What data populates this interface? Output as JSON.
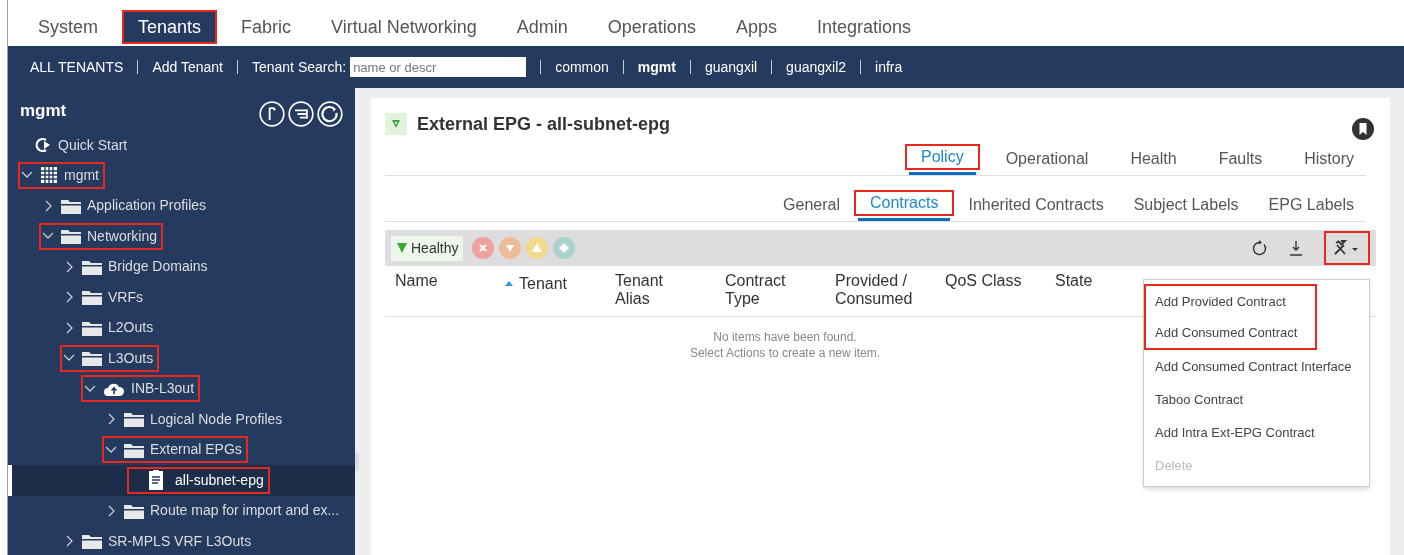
{
  "top_tabs": [
    {
      "label": "System",
      "selected": false,
      "highlighted": false
    },
    {
      "label": "Tenants",
      "selected": true,
      "highlighted": true
    },
    {
      "label": "Fabric",
      "selected": false,
      "highlighted": false
    },
    {
      "label": "Virtual Networking",
      "selected": false,
      "highlighted": false
    },
    {
      "label": "Admin",
      "selected": false,
      "highlighted": false
    },
    {
      "label": "Operations",
      "selected": false,
      "highlighted": false
    },
    {
      "label": "Apps",
      "selected": false,
      "highlighted": false
    },
    {
      "label": "Integrations",
      "selected": false,
      "highlighted": false
    }
  ],
  "tenant_bar": {
    "links": [
      "ALL TENANTS",
      "Add Tenant"
    ],
    "search_label": "Tenant Search:",
    "search_placeholder": "name or descr",
    "tenants": [
      {
        "label": "common",
        "selected": false
      },
      {
        "label": "mgmt",
        "selected": true
      },
      {
        "label": "guangxil",
        "selected": false
      },
      {
        "label": "guangxil2",
        "selected": false
      },
      {
        "label": "infra",
        "selected": false
      }
    ]
  },
  "sidebar": {
    "title": "mgmt",
    "quick_start": "Quick Start",
    "tree": [
      {
        "label": "mgmt",
        "kind": "tenant",
        "expanded": true,
        "selected": false,
        "highlighted": true,
        "children": [
          {
            "label": "Application Profiles",
            "kind": "folder",
            "expanded": false,
            "selected": false,
            "highlighted": false
          },
          {
            "label": "Networking",
            "kind": "folder",
            "expanded": true,
            "selected": false,
            "highlighted": true,
            "children": [
              {
                "label": "Bridge Domains",
                "kind": "folder",
                "expanded": false,
                "selected": false,
                "highlighted": false
              },
              {
                "label": "VRFs",
                "kind": "folder",
                "expanded": false,
                "selected": false,
                "highlighted": false
              },
              {
                "label": "L2Outs",
                "kind": "folder",
                "expanded": false,
                "selected": false,
                "highlighted": false
              },
              {
                "label": "L3Outs",
                "kind": "folder",
                "expanded": true,
                "selected": false,
                "highlighted": true,
                "children": [
                  {
                    "label": "INB-L3out",
                    "kind": "cloud",
                    "expanded": true,
                    "selected": false,
                    "highlighted": true,
                    "children": [
                      {
                        "label": "Logical Node Profiles",
                        "kind": "folder",
                        "expanded": false,
                        "selected": false,
                        "highlighted": false
                      },
                      {
                        "label": "External EPGs",
                        "kind": "folder",
                        "expanded": true,
                        "selected": false,
                        "highlighted": true,
                        "children": [
                          {
                            "label": "all-subnet-epg",
                            "kind": "document",
                            "selected": true,
                            "highlighted": true
                          }
                        ]
                      },
                      {
                        "label": "Route map for import and ex...",
                        "kind": "folder",
                        "expanded": false,
                        "selected": false,
                        "highlighted": false
                      }
                    ]
                  }
                ]
              },
              {
                "label": "SR-MPLS VRF L3Outs",
                "kind": "folder",
                "expanded": false,
                "selected": false,
                "highlighted": false
              }
            ]
          }
        ]
      }
    ]
  },
  "main": {
    "title": "External EPG - all-subnet-epg",
    "tabs": [
      {
        "label": "Policy",
        "selected": true,
        "highlighted": true
      },
      {
        "label": "Operational",
        "selected": false,
        "highlighted": false
      },
      {
        "label": "Health",
        "selected": false,
        "highlighted": false
      },
      {
        "label": "Faults",
        "selected": false,
        "highlighted": false
      },
      {
        "label": "History",
        "selected": false,
        "highlighted": false
      }
    ],
    "subtabs": [
      {
        "label": "General",
        "selected": false,
        "highlighted": false
      },
      {
        "label": "Contracts",
        "selected": true,
        "highlighted": true
      },
      {
        "label": "Inherited Contracts",
        "selected": false,
        "highlighted": false
      },
      {
        "label": "Subject Labels",
        "selected": false,
        "highlighted": false
      },
      {
        "label": "EPG Labels",
        "selected": false,
        "highlighted": false
      }
    ],
    "health": "Healthy",
    "actions_highlighted": true,
    "columns": [
      {
        "label": "Name",
        "sorted": false
      },
      {
        "label": "Tenant",
        "sorted": true
      },
      {
        "label": "Tenant\nAlias",
        "sorted": false
      },
      {
        "label": "Contract\nType",
        "sorted": false
      },
      {
        "label": "Provided /\nConsumed",
        "sorted": false
      },
      {
        "label": "QoS Class",
        "sorted": false
      },
      {
        "label": "State",
        "sorted": false
      }
    ],
    "empty_message": [
      "No items have been found.",
      "Select Actions to create a new item."
    ],
    "actions_menu": [
      {
        "label": "Add Provided Contract",
        "disabled": false,
        "highlighted": true
      },
      {
        "label": "Add Consumed Contract",
        "disabled": false,
        "highlighted": true
      },
      {
        "label": "Add Consumed Contract Interface",
        "disabled": false,
        "highlighted": false
      },
      {
        "label": "Taboo Contract",
        "disabled": false,
        "highlighted": false
      },
      {
        "label": "Add Intra Ext-EPG Contract",
        "disabled": false,
        "highlighted": false
      },
      {
        "label": "Delete",
        "disabled": true,
        "highlighted": false
      }
    ]
  }
}
